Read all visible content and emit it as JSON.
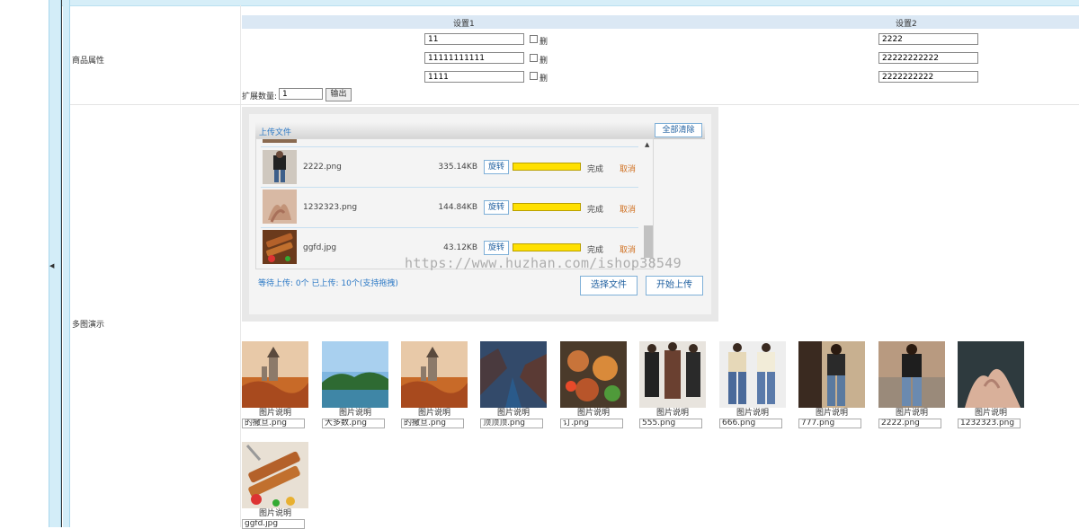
{
  "attribute_section": {
    "label": "商品属性",
    "columns": [
      "设置1",
      "设置2"
    ],
    "rows": [
      {
        "setting1": "11",
        "checkbox_label": "删",
        "setting2": "2222"
      },
      {
        "setting1": "11111111111",
        "checkbox_label": "删",
        "setting2": "22222222222"
      },
      {
        "setting1": "1111",
        "checkbox_label": "删",
        "setting2": "2222222222"
      }
    ],
    "expand_label": "扩展数量:",
    "expand_value": "1",
    "output_button": "输出"
  },
  "multi_image_section": {
    "label": "多图演示",
    "uploader": {
      "title": "上传文件",
      "clear_all": "全部清除",
      "files": [
        {
          "name": "2222.png",
          "size": "335.14KB",
          "rotate": "旋转",
          "progress": 1.0,
          "status": "完成",
          "cancel": "取消"
        },
        {
          "name": "1232323.png",
          "size": "144.84KB",
          "rotate": "旋转",
          "progress": 1.0,
          "status": "完成",
          "cancel": "取消"
        },
        {
          "name": "ggfd.jpg",
          "size": "43.12KB",
          "rotate": "旋转",
          "progress": 1.0,
          "status": "完成",
          "cancel": "取消"
        }
      ],
      "status_text": "等待上传: 0个 已上传: 10个(支持拖拽)",
      "select_button": "选择文件",
      "start_button": "开始上传"
    },
    "watermark": "https://www.huzhan.com/ishop38549",
    "gallery": [
      {
        "caption": "图片说明",
        "filename": "的撒旦.png",
        "kind": "castle"
      },
      {
        "caption": "图片说明",
        "filename": "大多数.png",
        "kind": "lake"
      },
      {
        "caption": "图片说明",
        "filename": "的撒旦.png",
        "kind": "castle"
      },
      {
        "caption": "图片说明",
        "filename": "顶顶顶.png",
        "kind": "fjord"
      },
      {
        "caption": "图片说明",
        "filename": "订.png",
        "kind": "food"
      },
      {
        "caption": "图片说明",
        "filename": "555.png",
        "kind": "coats"
      },
      {
        "caption": "图片说明",
        "filename": "666.png",
        "kind": "jeans"
      },
      {
        "caption": "图片说明",
        "filename": "777.png",
        "kind": "fashion"
      },
      {
        "caption": "图片说明",
        "filename": "2222.png",
        "kind": "street"
      },
      {
        "caption": "图片说明",
        "filename": "1232323.png",
        "kind": "hands"
      },
      {
        "caption": "图片说明",
        "filename": "ggfd.jpg",
        "kind": "skewer"
      }
    ]
  },
  "colors": {
    "accent": "#2b78c5",
    "progress": "#ffe000",
    "cancel": "#d07020",
    "sidebar": "#d3edf8"
  }
}
